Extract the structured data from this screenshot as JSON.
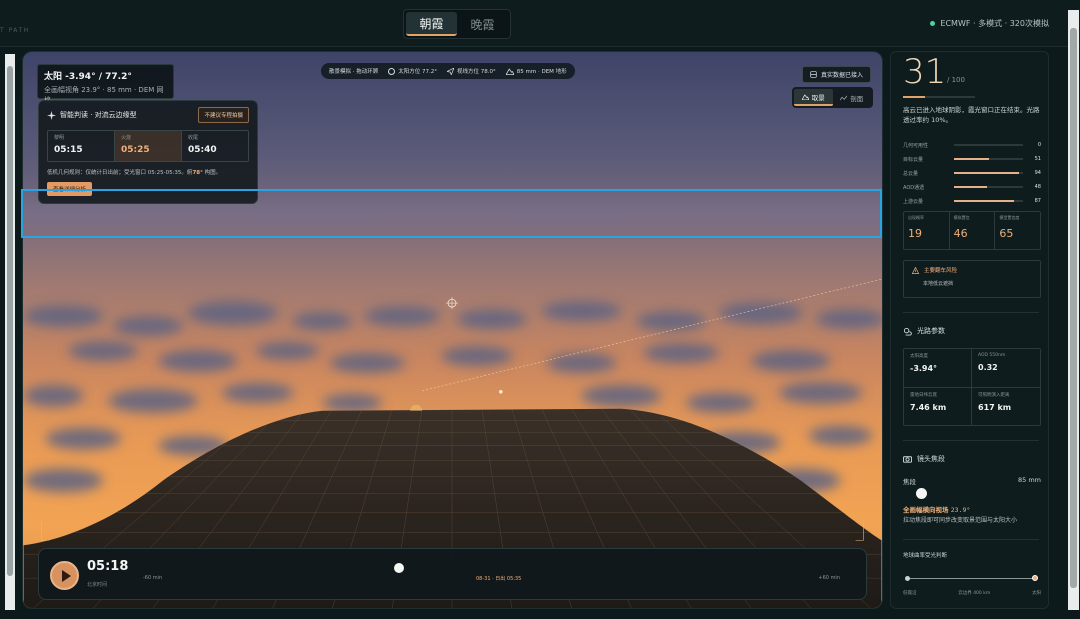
{
  "header": {
    "brand_fragment": "T PATH",
    "tabs": [
      {
        "label": "朝霞",
        "active": true
      },
      {
        "label": "晚霞",
        "active": false
      }
    ],
    "model_info": "ECMWF · 多模式 · 320次模拟"
  },
  "viewport": {
    "sun_box": {
      "title": "太阳 -3.94° / 77.2°",
      "subtitle": "全画幅视角 23.9° · 85 mm · DEM 网格"
    },
    "pills": {
      "mode": "散景模拟 · 拖动环顾",
      "sun_azimuth": "太阳方位 77.2°",
      "view_azimuth": "视线方位 78.0°",
      "lens": "85 mm · DEM 地形"
    },
    "data_button": "真实数据已接入",
    "view_toggle": [
      {
        "label": "取景",
        "active": true
      },
      {
        "label": "剖面",
        "active": false
      }
    ],
    "prediction": {
      "title": "智能判读 · 对流云边缘型",
      "tag": "不建议专程拍摄",
      "times": [
        {
          "label": "黎明",
          "value": "05:15",
          "active": false
        },
        {
          "label": "火烧",
          "value": "05:25",
          "active": true
        },
        {
          "label": "收尾",
          "value": "05:40",
          "active": false
        }
      ],
      "note_prefix": "低机几何规则：仅统计日出前；受光窗口 05:25-05:35。俯",
      "note_bold": "78°",
      "note_suffix": " 构图。",
      "button": "查看详细分析"
    },
    "timeline": {
      "time": "05:18",
      "subtitle": "北京时间",
      "left_label": "-60 min",
      "right_label": "+60 min",
      "mid_label": "08-31 · 日出 05:35"
    }
  },
  "panel": {
    "score": "31",
    "score_max": "/ 100",
    "score_fraction": 0.31,
    "description": "高云已进入地球阴影，霞光窗口正在结束。光路透过率约 10%。",
    "metrics": [
      {
        "label": "几何可用性",
        "value": "0",
        "fill": 0.0
      },
      {
        "label": "目标云量",
        "value": "51",
        "fill": 0.51
      },
      {
        "label": "总云量",
        "value": "94",
        "fill": 0.94
      },
      {
        "label": "AOD通透",
        "value": "48",
        "fill": 0.48
      },
      {
        "label": "上游云量",
        "value": "87",
        "fill": 0.87
      }
    ],
    "probabilities": [
      {
        "label": "出现概率",
        "value": "19"
      },
      {
        "label": "模拟置信",
        "value": "46"
      },
      {
        "label": "模型置信度",
        "value": "65"
      }
    ],
    "risk": {
      "title": "主要翻车风险",
      "subtitle": "本地低云遮挡"
    },
    "path_section": {
      "title": "光路参数",
      "params": [
        {
          "label": "太阳高度",
          "value": "-3.94°"
        },
        {
          "label": "AOD 550nm",
          "value": "0.32"
        },
        {
          "label": "雷地日纬云底",
          "value": "7.46 km"
        },
        {
          "label": "可照明演入距离",
          "value": "617 km"
        }
      ]
    },
    "lens_section": {
      "title": "镜头焦段",
      "focal_label": "焦段",
      "focal_value": "85 mm",
      "highlight_prefix": "全画幅横向视场",
      "highlight_value": "23.9°",
      "description": "拉动焦段即可同步改变取景范围与太阳大小"
    },
    "curvature": {
      "title": "地球曲率受光判断",
      "left": "低霞沿",
      "mid": "云边界 400 km",
      "right": "太阳"
    }
  }
}
